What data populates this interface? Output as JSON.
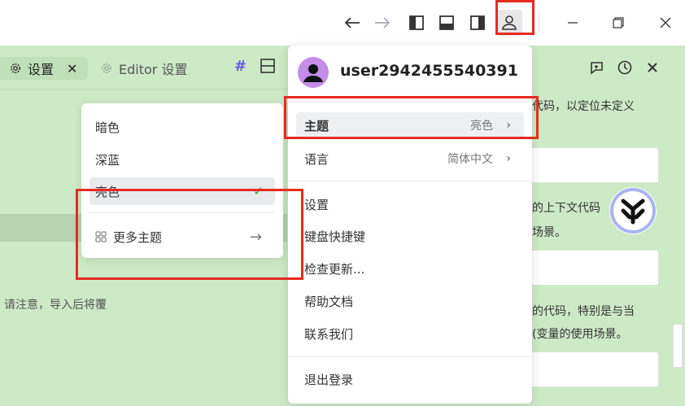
{
  "titlebar": {
    "back_icon": "arrow-left-icon",
    "forward_icon": "arrow-right-icon",
    "layout_icons": [
      "panel-left-icon",
      "panel-bottom-icon",
      "panel-right-icon"
    ],
    "user_icon": "user-icon",
    "minimize_icon": "minimize-icon",
    "maximize_icon": "maximize-icon",
    "close_icon": "close-icon"
  },
  "tabs": [
    {
      "label": "设置",
      "close": "✕"
    },
    {
      "label": "Editor 设置"
    }
  ],
  "toolbar": {
    "hash": "#"
  },
  "note": "请注意，导入后将覆",
  "right_panel": {
    "texts": [
      "代码，以定位未定义",
      "的上下文代码",
      "场景。",
      "的代码，特别是与当",
      "(变量的使用场景。"
    ]
  },
  "theme_menu": {
    "items": [
      {
        "label": "暗色"
      },
      {
        "label": "深蓝"
      },
      {
        "label": "亮色",
        "check": "✓"
      }
    ],
    "more": {
      "label": "更多主题",
      "arrow": "→"
    }
  },
  "user_menu": {
    "username": "user2942455540391",
    "theme": {
      "label": "主题",
      "value": "亮色",
      "chevron": "›"
    },
    "language": {
      "label": "语言",
      "value": "简体中文",
      "chevron": "›"
    },
    "items": [
      "设置",
      "键盘快捷键",
      "检查更新...",
      "帮助文档",
      "联系我们"
    ],
    "logout": "退出登录"
  },
  "colors": {
    "background": "#cdeac6",
    "highlight_border": "#e52b21",
    "avatar": "#c38de8",
    "check": "#3a9b3a"
  }
}
